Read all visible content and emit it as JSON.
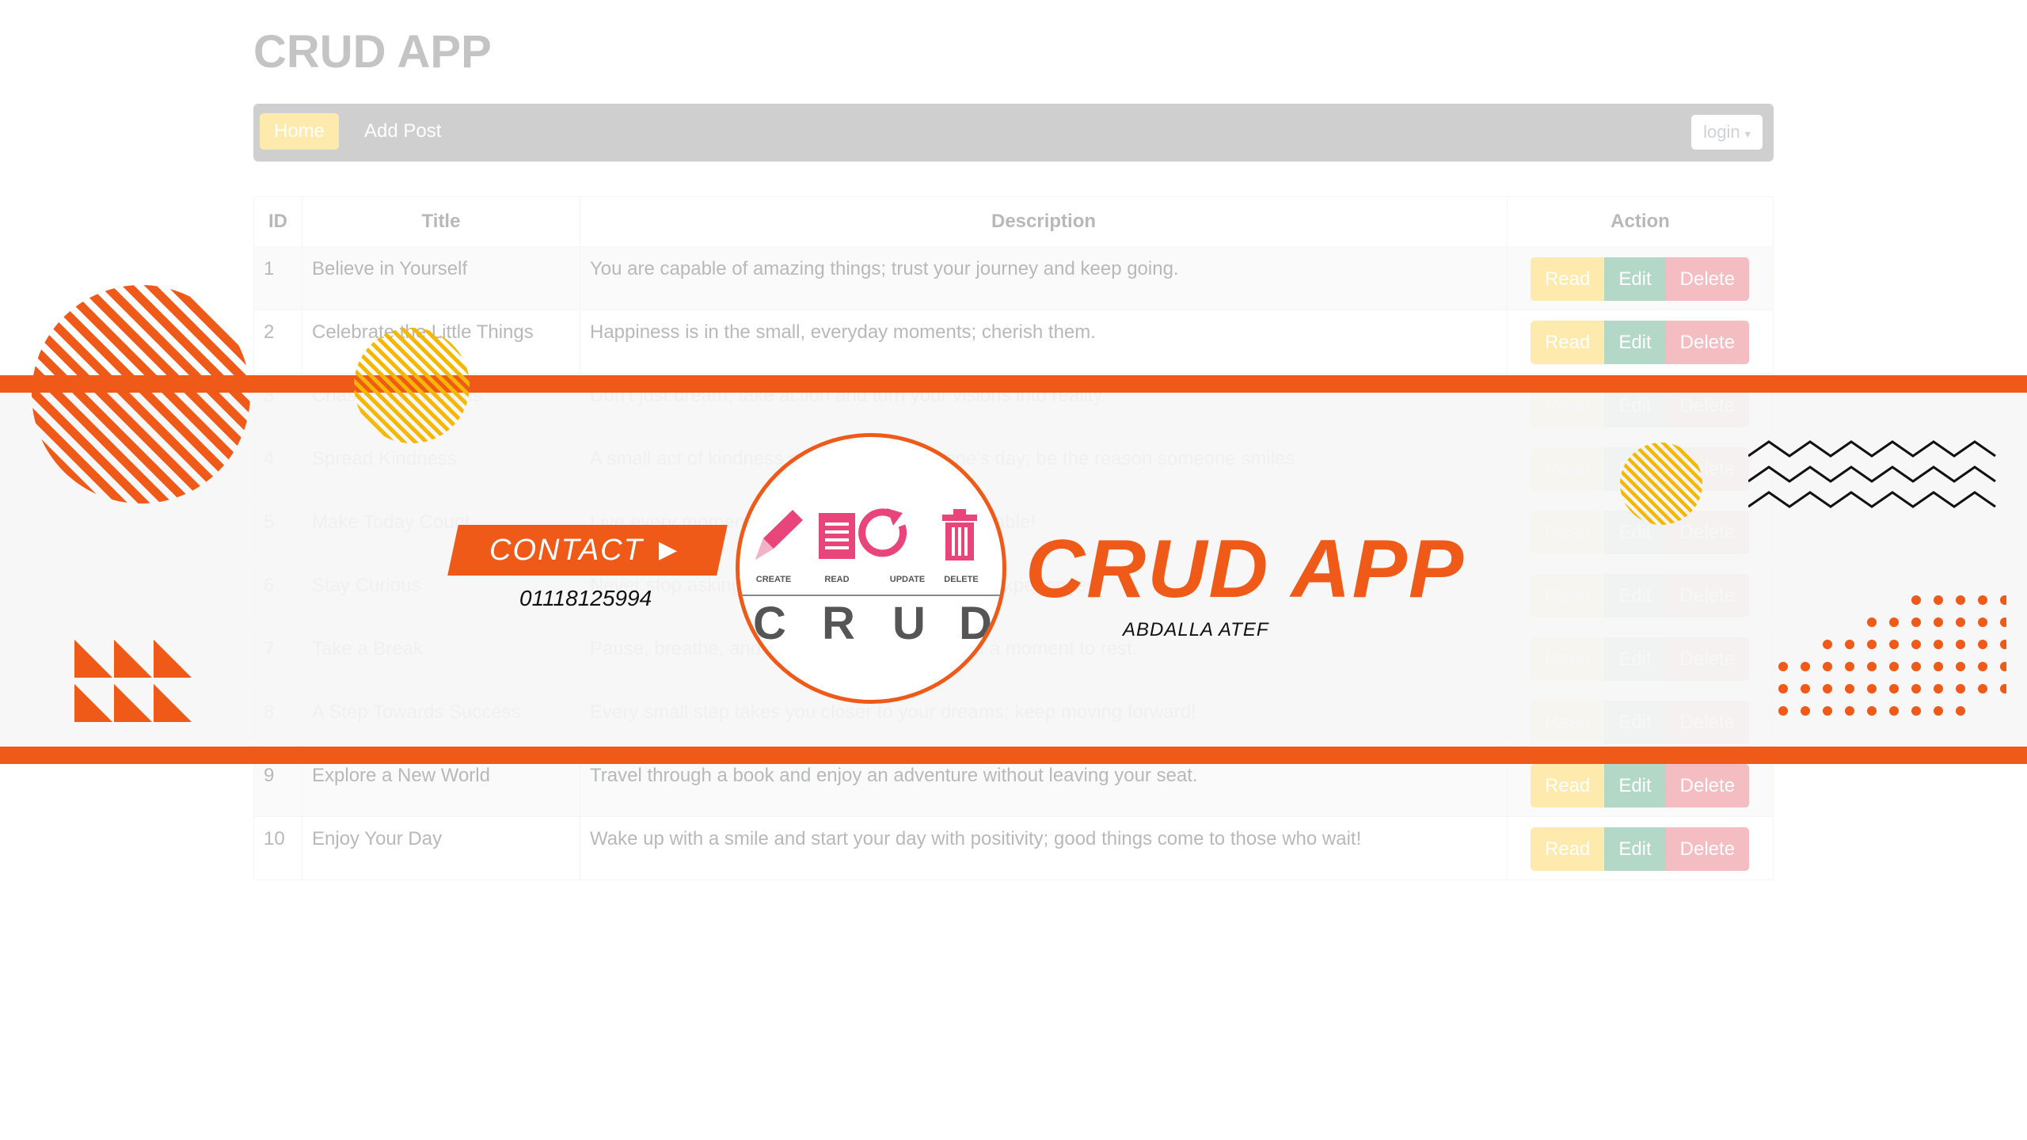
{
  "app": {
    "title": "CRUD APP",
    "nav": {
      "home": "Home",
      "add_post": "Add Post",
      "login": "login"
    },
    "table": {
      "headers": [
        "ID",
        "Title",
        "Description",
        "Action"
      ],
      "actions": {
        "read": "Read",
        "edit": "Edit",
        "delete": "Delete"
      },
      "rows": [
        {
          "id": "1",
          "title": "Believe in Yourself",
          "description": "You are capable of amazing things; trust your journey and keep going."
        },
        {
          "id": "2",
          "title": "Celebrate the Little Things",
          "description": "Happiness is in the small, everyday moments; cherish them."
        },
        {
          "id": "3",
          "title": "Chase Your Dreams",
          "description": "Don't just dream, take action and turn your visions into reality."
        },
        {
          "id": "4",
          "title": "Spread Kindness",
          "description": "A small act of kindness can brighten someone's day; be the reason someone smiles."
        },
        {
          "id": "5",
          "title": "Make Today Count",
          "description": "Live every moment fully and make today memorable!"
        },
        {
          "id": "6",
          "title": "Stay Curious",
          "description": "Never stop asking questions and exploring new experiences."
        },
        {
          "id": "7",
          "title": "Take a Break",
          "description": "Pause, breathe, and relax; it's okay if you need a moment to rest."
        },
        {
          "id": "8",
          "title": "A Step Towards Success",
          "description": "Every small step takes you closer to your dreams; keep moving forward!"
        },
        {
          "id": "9",
          "title": "Explore a New World",
          "description": "Travel through a book and enjoy an adventure without leaving your seat."
        },
        {
          "id": "10",
          "title": "Enjoy Your Day",
          "description": "Wake up with a smile and start your day with positivity; good things come to those who wait!"
        }
      ]
    }
  },
  "banner": {
    "contact_label": "CONTACT",
    "phone": "01118125994",
    "brand_title": "CRUD APP",
    "author": "ABDALLA ATEF",
    "crud_labels": [
      "CREATE",
      "READ",
      "UPDATE",
      "DELETE"
    ],
    "crud_letters": [
      "C",
      "R",
      "U",
      "D"
    ]
  },
  "colors": {
    "accent": "#f05a19",
    "yellow": "#f5b700",
    "pink": "#e8457a",
    "navbar": "#6e6e6e",
    "read_button": "#ffc107",
    "edit_button": "#198754",
    "delete_button": "#dc3545"
  },
  "icons": [
    "pencil-icon",
    "document-icon",
    "refresh-icon",
    "trash-icon",
    "play-arrow-icon",
    "caret-down-icon"
  ]
}
